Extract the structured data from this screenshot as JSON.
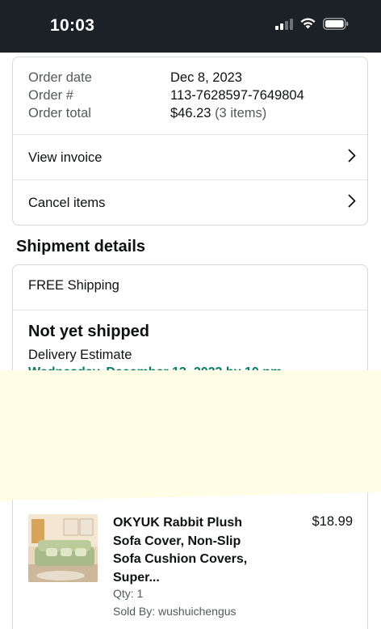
{
  "status_bar": {
    "time": "10:03",
    "icons": [
      "cellular-signal-icon",
      "wifi-icon",
      "battery-icon"
    ]
  },
  "order": {
    "date_label": "Order date",
    "date_value": "Dec 8, 2023",
    "number_label": "Order #",
    "number_value": "113-7628597-7649804",
    "total_label": "Order total",
    "total_value": "$46.23",
    "total_items": "(3 items)",
    "view_invoice": "View invoice",
    "cancel_items": "Cancel items"
  },
  "shipment": {
    "section_title": "Shipment details",
    "shipping_method": "FREE Shipping",
    "status": "Not yet shipped",
    "delivery_label": "Delivery Estimate",
    "delivery_date": "Wednesday, December 13, 2023 by 10 pm"
  },
  "item": {
    "title": "OKYUK Rabbit Plush Sofa Cover, Non-Slip Sofa Cushion Covers, Super...",
    "price": "$18.99",
    "qty": "Qty: 1",
    "sold_by": "Sold By: wushuichengus"
  },
  "colors": {
    "status_bar_bg": "#1c2127",
    "delivery_green": "#067d62",
    "overlay_yellow": "#fffde6"
  }
}
